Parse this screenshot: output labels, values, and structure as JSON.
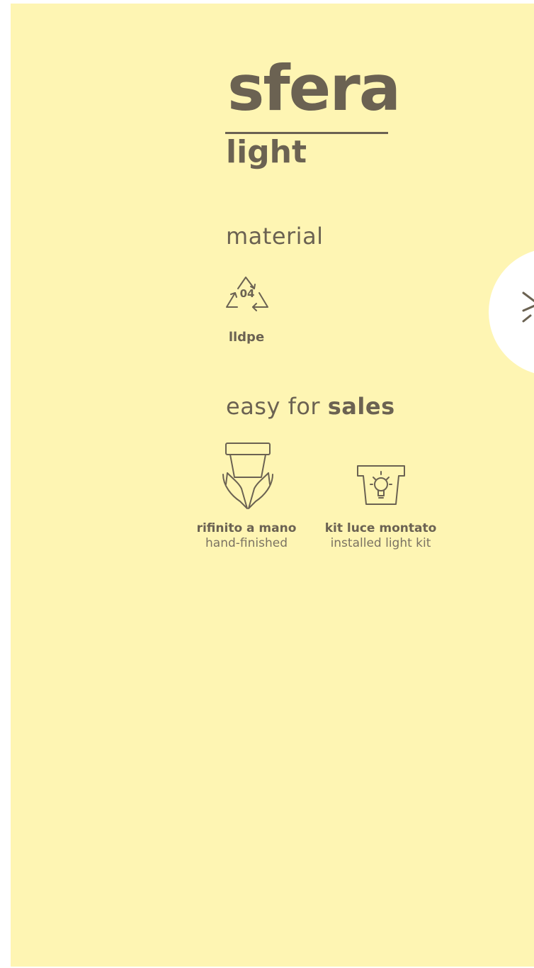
{
  "brand": {
    "title": "sfera",
    "subtitle": "light"
  },
  "material": {
    "heading": "material",
    "recycle_code": "04",
    "code_label": "lldpe",
    "icon": "recycle-icon"
  },
  "sales": {
    "heading_light": "easy for ",
    "heading_bold": "sales",
    "features": [
      {
        "title": "rifinito a mano",
        "description": "hand-finished",
        "icon": "hands-holding-pot-icon"
      },
      {
        "title": "kit luce montato",
        "description": "installed light kit",
        "icon": "lightbulb-pot-icon"
      }
    ]
  },
  "navigation": {
    "next_icon": "chevron-right-icon"
  },
  "colors": {
    "background": "#fef5b3",
    "text": "#6b6252",
    "tab": "#ffffff"
  }
}
